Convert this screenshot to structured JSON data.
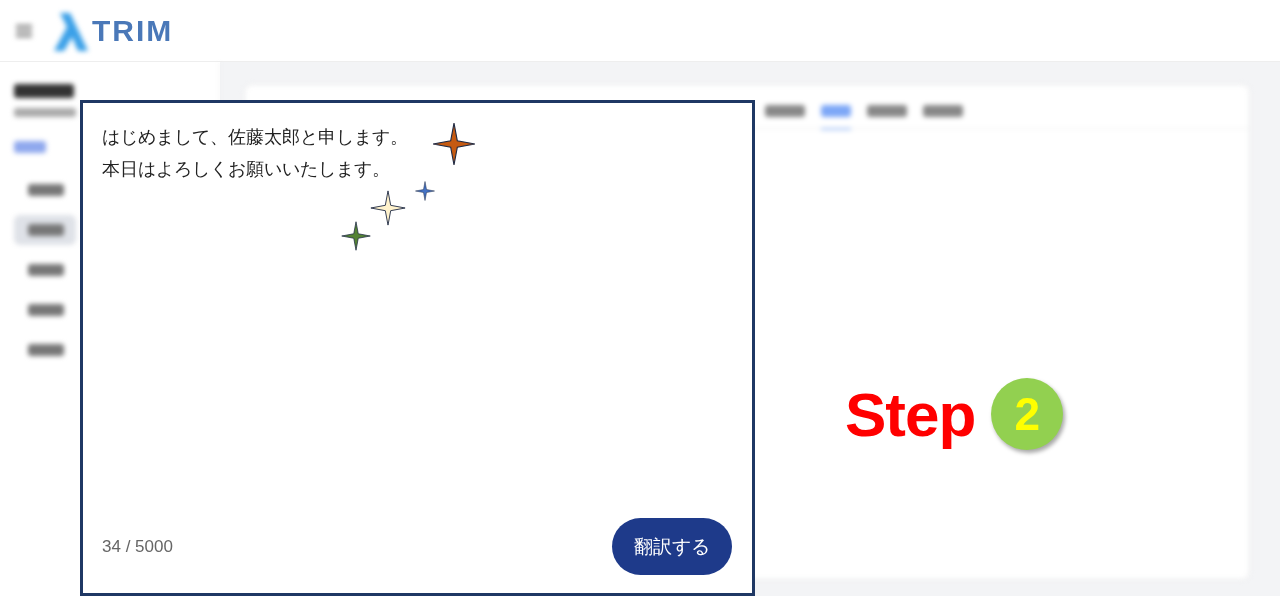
{
  "header": {
    "logo_text": "TRIM"
  },
  "sidebar": {
    "items": [
      {
        "selected": false
      },
      {
        "selected": true
      },
      {
        "selected": false
      },
      {
        "selected": false
      },
      {
        "selected": false
      }
    ]
  },
  "target_tabs": [
    {
      "selected": false
    },
    {
      "selected": true
    },
    {
      "selected": false
    },
    {
      "selected": false
    }
  ],
  "input_panel": {
    "text_lines": [
      "はじめまして、佐藤太郎と申します。",
      "本日はよろしくお願いいたします。"
    ],
    "counter": "34 / 5000",
    "button": "翻訳する"
  },
  "sparkles": [
    {
      "color": "#c55a11"
    },
    {
      "color": "#4472c4"
    },
    {
      "color": "#fff2cc"
    },
    {
      "color": "#548235"
    }
  ],
  "step": {
    "label": "Step",
    "number": "2"
  }
}
